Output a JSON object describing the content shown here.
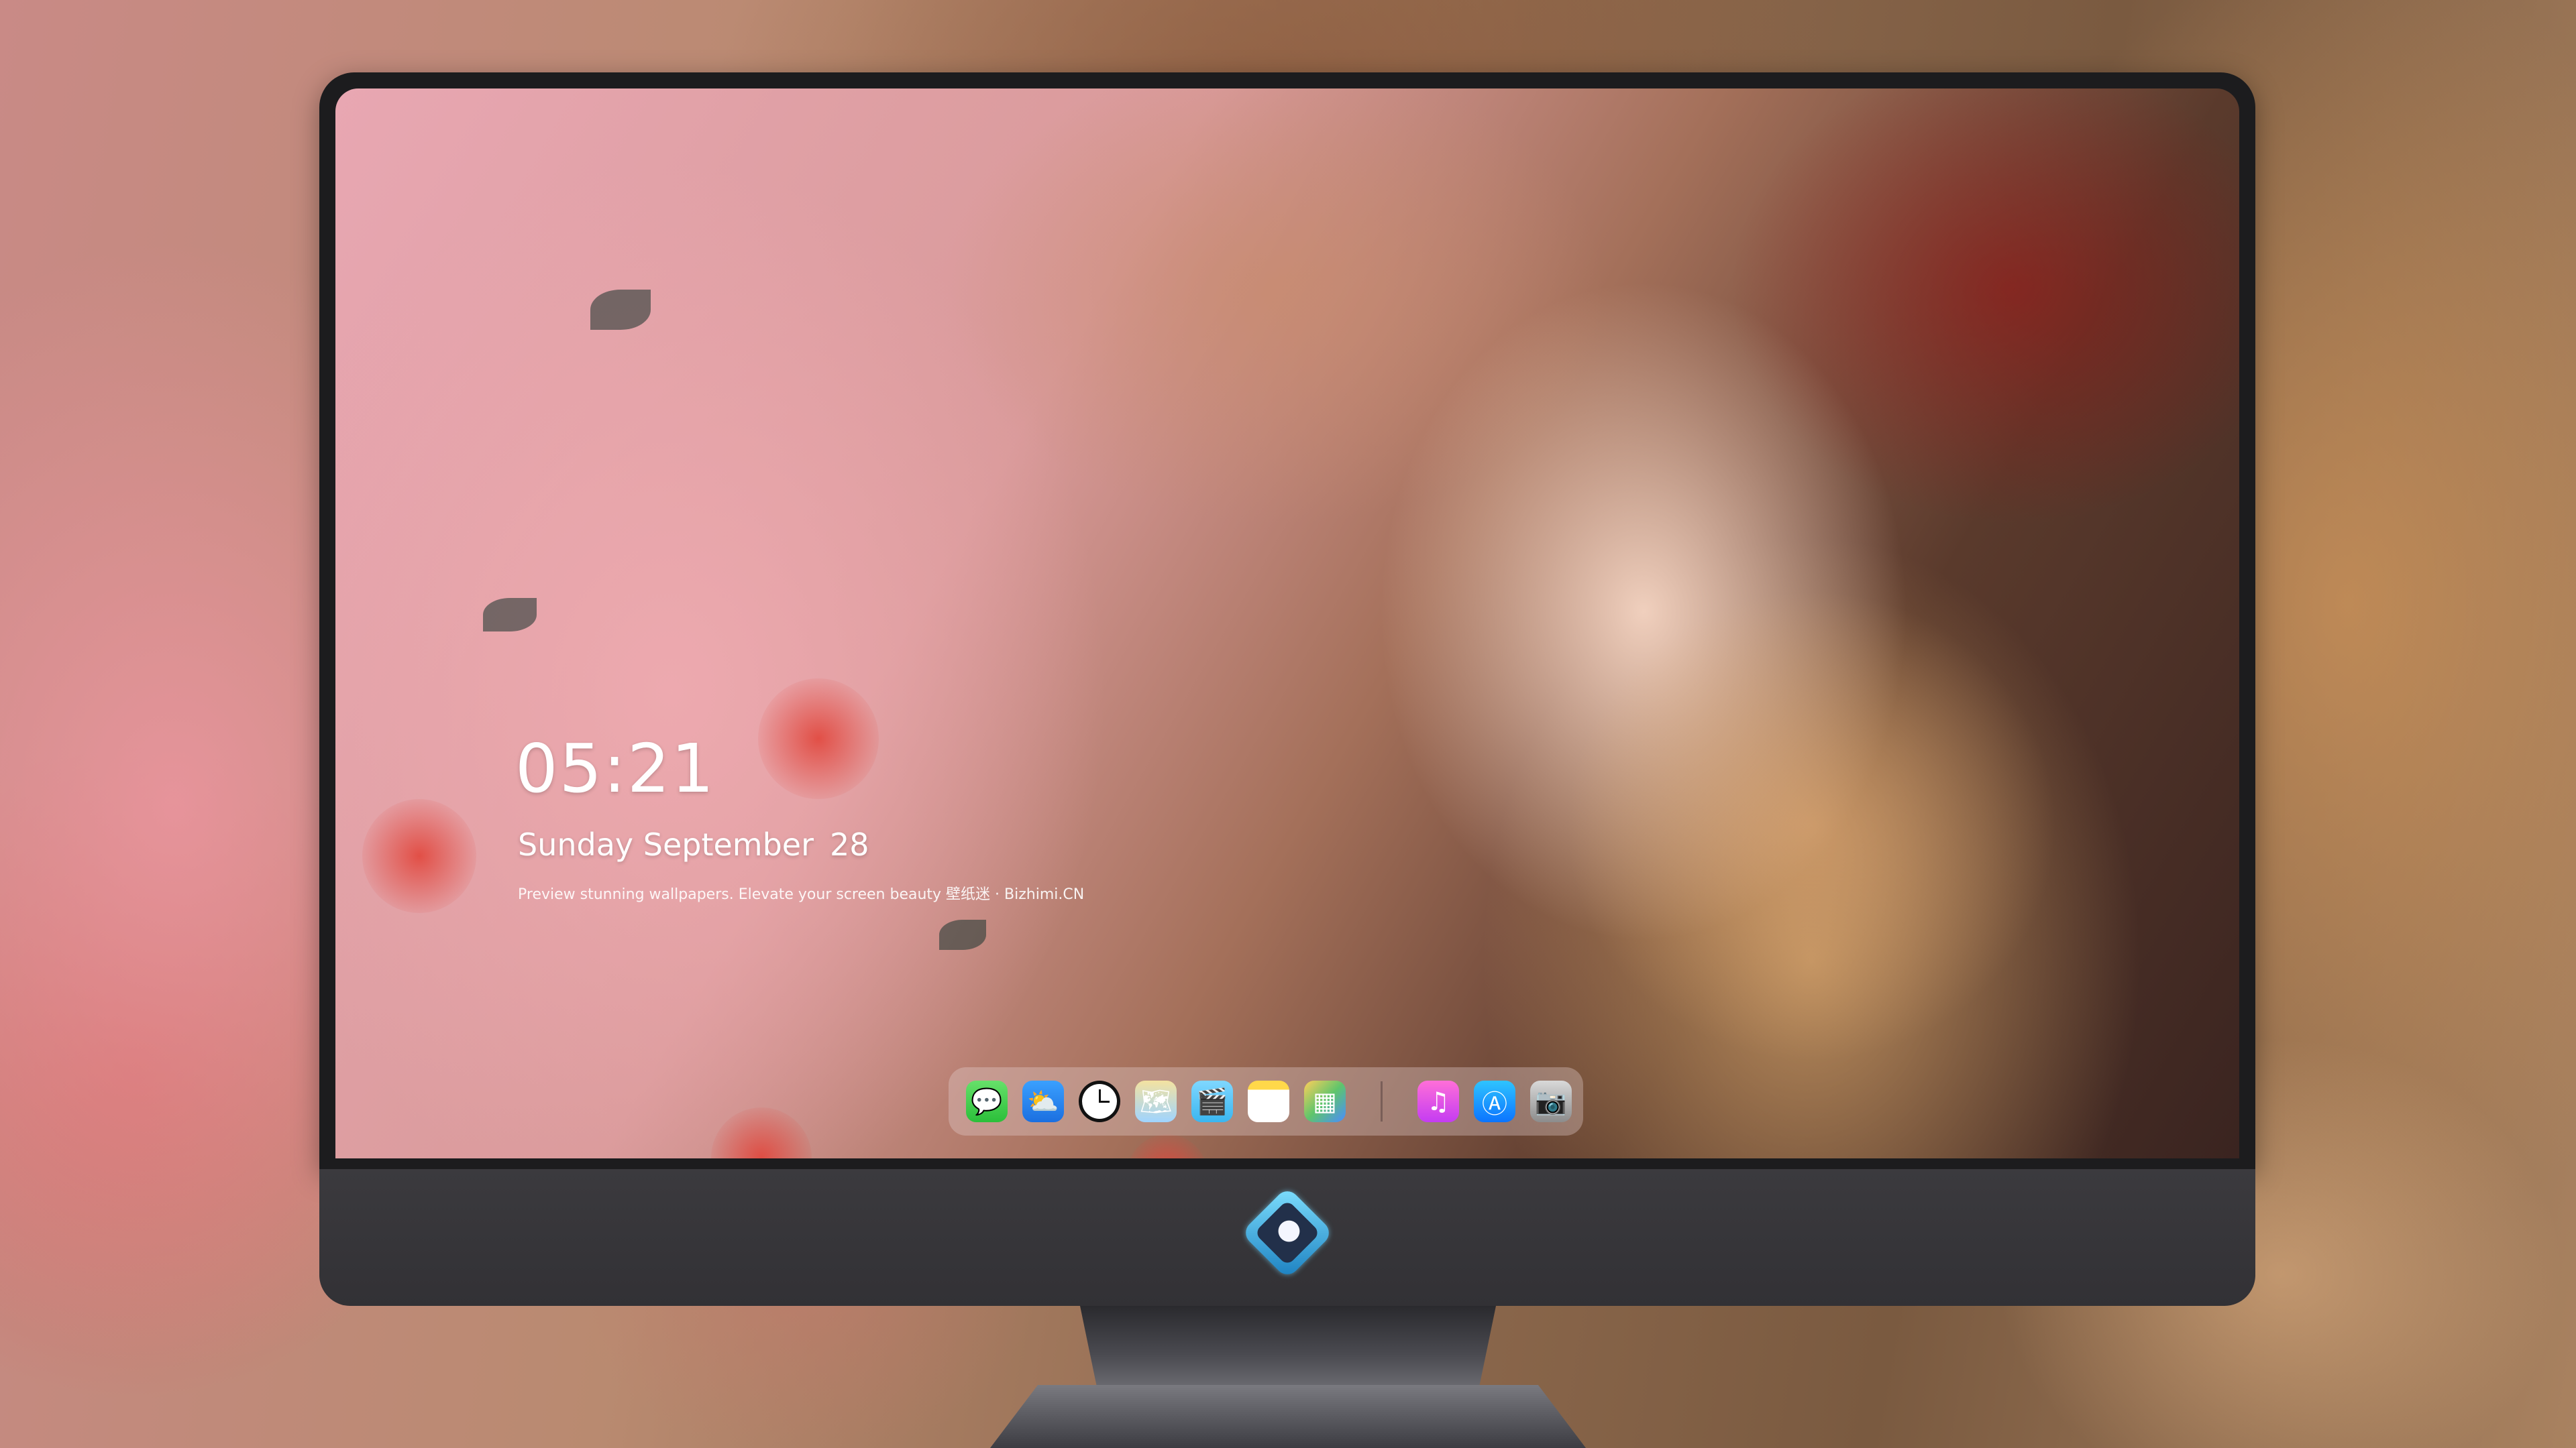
{
  "lock_screen": {
    "time": "05:21",
    "date_text": "Sunday September",
    "day_number": "28",
    "tagline": "Preview stunning wallpapers. Elevate your screen beauty  壁纸迷 · Bizhimi.CN"
  },
  "dock": {
    "apps": [
      {
        "name": "messages",
        "icon": "chat-bubble-icon",
        "glyph": "💬",
        "color": "#2bbf3a"
      },
      {
        "name": "weather",
        "icon": "cloud-sun-icon",
        "glyph": "⛅",
        "color": "#1b6fe0"
      },
      {
        "name": "clock",
        "icon": "clock-icon",
        "glyph": "",
        "color": "#111111"
      },
      {
        "name": "maps",
        "icon": "map-icon",
        "glyph": "🗺",
        "color": "#9fd4ff"
      },
      {
        "name": "clips",
        "icon": "clapperboard-icon",
        "glyph": "🎬",
        "color": "#3ab6f0"
      },
      {
        "name": "notes",
        "icon": "notes-icon",
        "glyph": "",
        "color": "#ffd84a"
      },
      {
        "name": "photos",
        "icon": "photos-icon",
        "glyph": "▦",
        "color": "#5fc56b"
      },
      {
        "name": "music",
        "icon": "music-note-icon",
        "glyph": "♫",
        "color": "#c43cf2"
      },
      {
        "name": "app-store",
        "icon": "app-store-icon",
        "glyph": "Ⓐ",
        "color": "#0b74ff"
      },
      {
        "name": "camera",
        "icon": "camera-icon",
        "glyph": "📷",
        "color": "#8c8c8c"
      }
    ]
  },
  "brand": {
    "logo_icon": "bizhimi-mascot-logo-icon"
  }
}
